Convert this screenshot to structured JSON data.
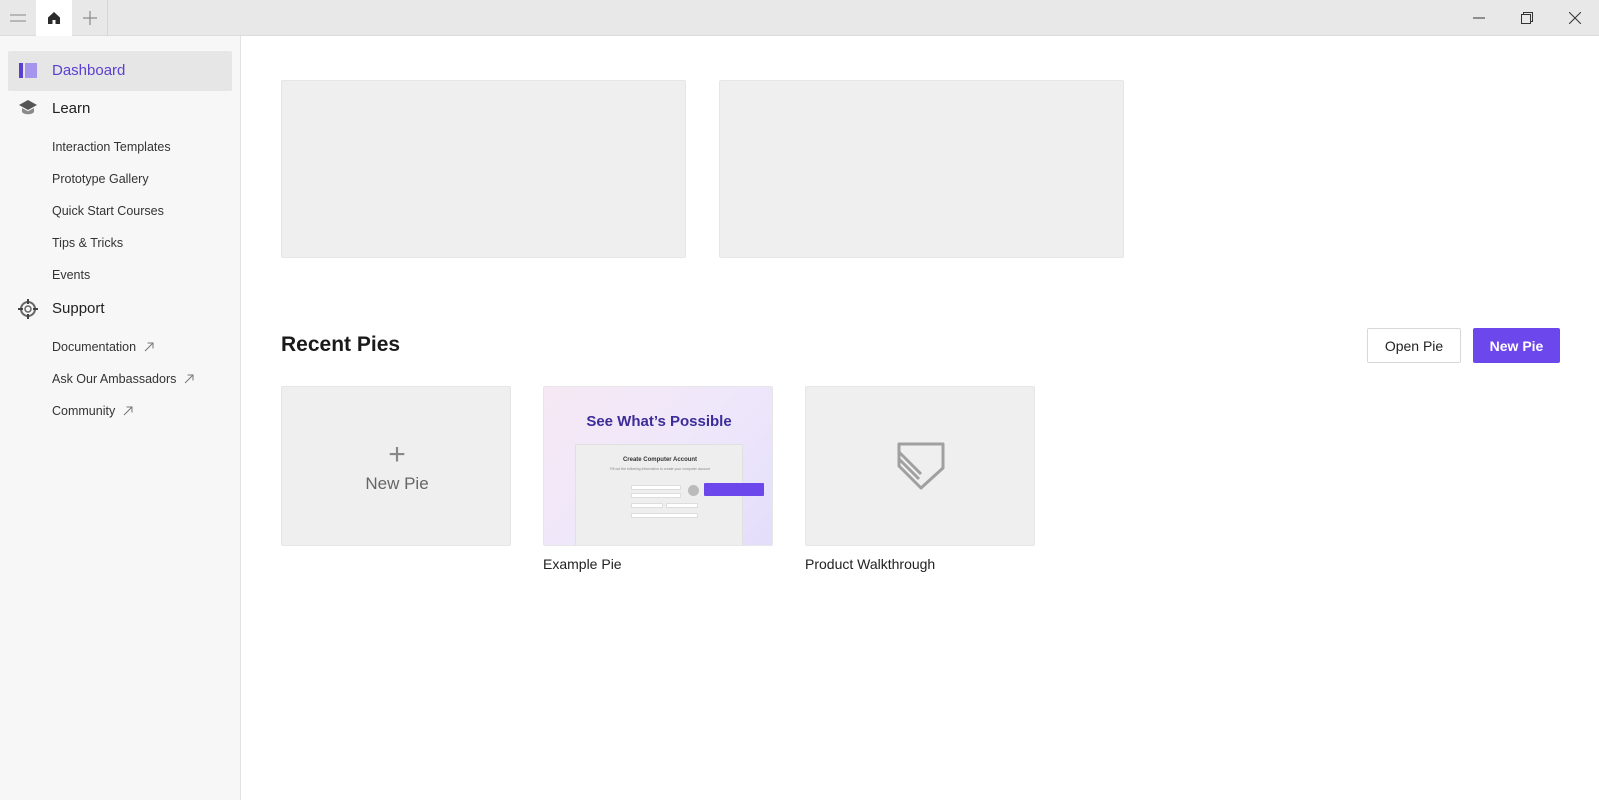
{
  "titlebar": {
    "menu_icon": "menu-icon",
    "home_icon": "home-icon",
    "add_tab_icon": "plus-icon",
    "window_controls": [
      "minimize-icon",
      "maximize-icon",
      "close-icon"
    ]
  },
  "sidebar": {
    "active": {
      "label": "Dashboard",
      "icon": "dashboard-icon",
      "color": "#5b3fd1"
    },
    "learn": {
      "label": "Learn",
      "icon": "graduation-cap-icon",
      "items": [
        "Interaction Templates",
        "Prototype Gallery",
        "Quick Start Courses",
        "Tips & Tricks",
        "Events"
      ]
    },
    "support": {
      "label": "Support",
      "icon": "lifebuoy-icon",
      "items": [
        "Documentation",
        "Ask Our Ambassadors",
        "Community"
      ]
    }
  },
  "main": {
    "recent_title": "Recent Pies",
    "open_button": "Open Pie",
    "new_button": "New Pie",
    "accent": "#6b47ec",
    "cards": {
      "new_pie": {
        "plus": "+",
        "label": "New Pie"
      },
      "example": {
        "name": "Example Pie",
        "thumb_title": "See What’s Possible",
        "mock_heading": "Create Computer Account",
        "mock_subheading": "Fill out the following information to create your computer account"
      },
      "walkthrough": {
        "name": "Product Walkthrough",
        "icon": "protopie-logo-icon"
      }
    }
  }
}
